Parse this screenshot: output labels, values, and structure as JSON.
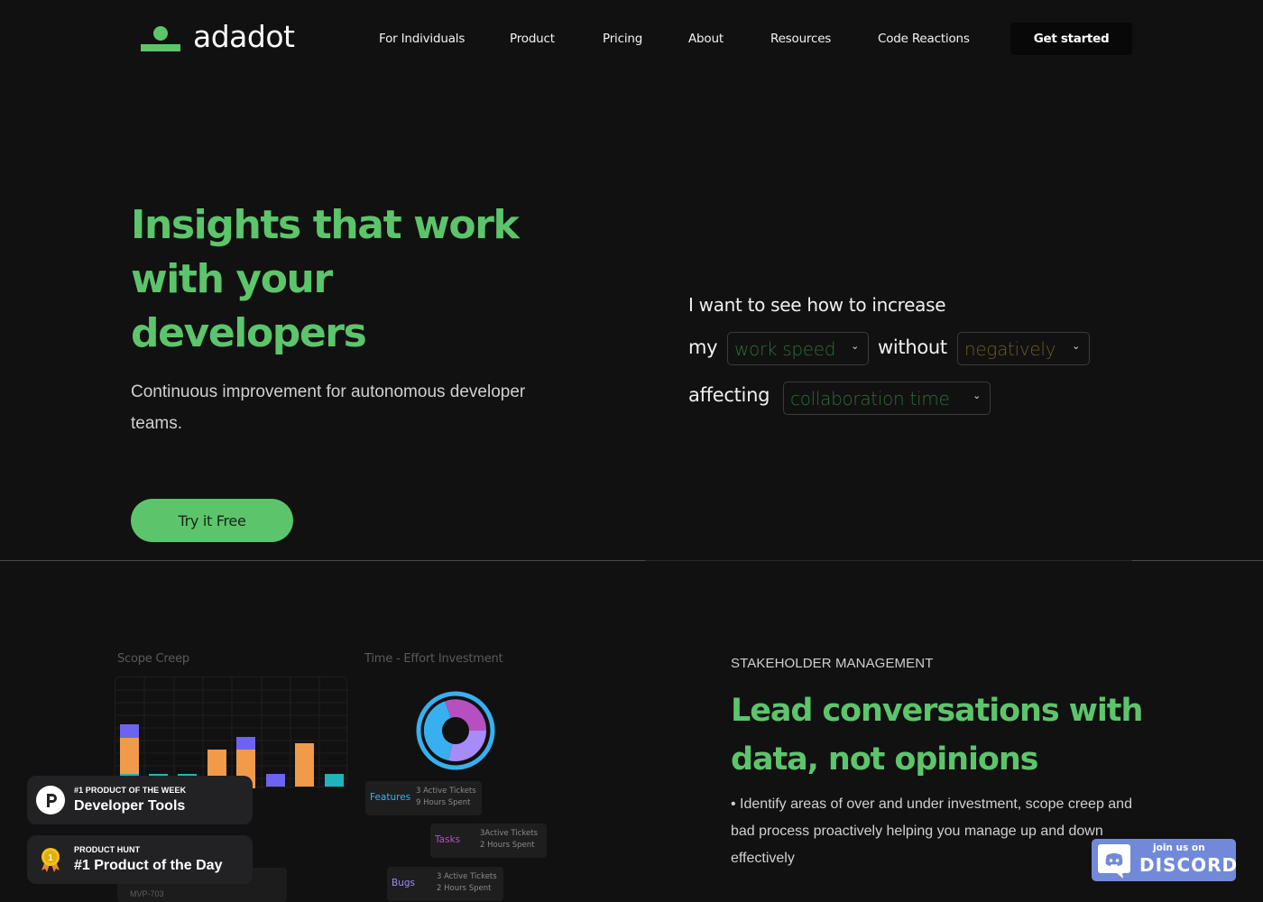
{
  "brand": {
    "name": "adadot",
    "accent": "#5cc56b"
  },
  "nav": {
    "links": [
      "For Individuals",
      "Product",
      "Pricing",
      "About",
      "Resources",
      "Code Reactions"
    ],
    "cta": "Get started"
  },
  "hero": {
    "title": "Insights that work with your developers",
    "subtitle": "Continuous improvement for autonomous developer teams.",
    "cta": "Try it Free",
    "sentence": {
      "line1": "I want to see how to increase",
      "my": "my",
      "without": "without",
      "affecting": "affecting",
      "select1": {
        "value": "work speed",
        "color": "#2f6b36"
      },
      "select2": {
        "value": "negatively",
        "color": "#6b5a20"
      },
      "select3": {
        "value": "collaboration time",
        "color": "#2f6b36"
      }
    }
  },
  "section2": {
    "eyebrow": "STAKEHOLDER MANAGEMENT",
    "title": "Lead conversations with data, not opinions",
    "body": "• Identify areas of over and under investment, scope creep and bad process proactively helping you manage up and down effectively",
    "scope_creep": {
      "title": "Scope Creep",
      "colors": {
        "orange": "#f09a4a",
        "purple": "#6d63f0",
        "teal": "#1fb5b8"
      }
    },
    "time_effort": {
      "title": "Time - Effort Investment",
      "cards": [
        {
          "label": "Features",
          "line1": "3 Active Tickets",
          "line2": "9 Hours Spent",
          "color": "#38b0f0"
        },
        {
          "label": "Tasks",
          "line1": "3Active Tickets",
          "line2": "2 Hours Spent",
          "color": "#b650c0"
        },
        {
          "label": "Bugs",
          "line1": "3 Active Tickets",
          "line2": "2 Hours Spent",
          "color": "#9a8cf5"
        }
      ]
    },
    "mvp_card": {
      "id": "MVP-703"
    }
  },
  "badges": [
    {
      "small": "#1 PRODUCT OF THE WEEK",
      "big": "Developer Tools"
    },
    {
      "small": "PRODUCT HUNT",
      "big": "#1 Product of the Day"
    }
  ],
  "discord": {
    "join": "join us on",
    "word": "DISCORD"
  }
}
